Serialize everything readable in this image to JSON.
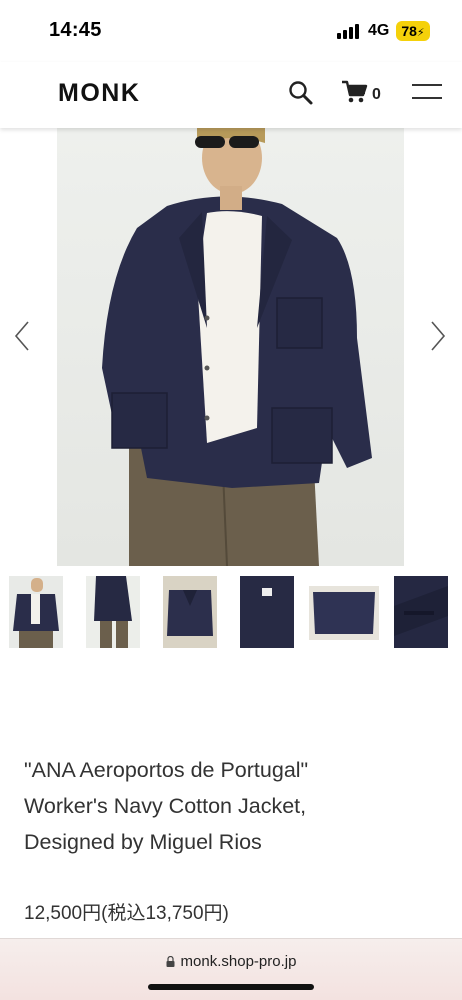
{
  "status": {
    "time": "14:45",
    "network": "4G",
    "battery": "78"
  },
  "header": {
    "logo": "MONK",
    "cart_count": "0"
  },
  "icons": {
    "search": "search-icon",
    "cart": "cart-icon",
    "menu": "hamburger-menu-icon",
    "prev": "chevron-left-icon",
    "next": "chevron-right-icon",
    "lock": "lock-icon"
  },
  "gallery": {
    "thumbnail_count": 6
  },
  "product": {
    "title_lines": [
      "\"ANA Aeroportos de Portugal\"",
      "Worker's Navy Cotton Jacket,",
      "Designed by Miguel Rios"
    ],
    "price": "12,500円(税込13,750円)"
  },
  "browser": {
    "url": "monk.shop-pro.jp"
  },
  "colors": {
    "jacket_navy": "#2a2d4a",
    "battery_yellow": "#f5d10a"
  }
}
